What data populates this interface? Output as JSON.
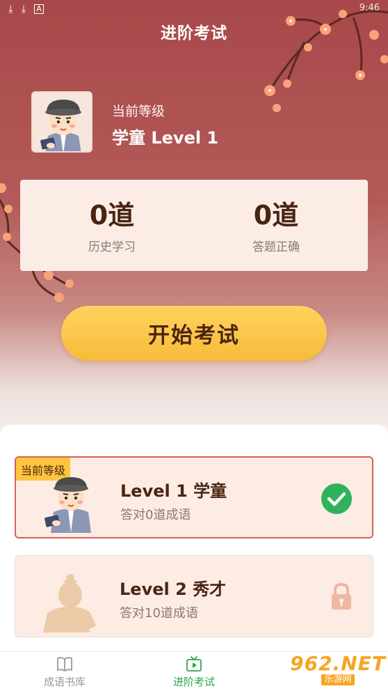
{
  "status_bar": {
    "icons": [
      "download-icon",
      "download-icon",
      "a-icon"
    ],
    "time": "9:46"
  },
  "header": {
    "title": "进阶考试"
  },
  "profile": {
    "level_label": "当前等级",
    "level_value": "学童 Level 1"
  },
  "stats": [
    {
      "value": "0道",
      "label": "历史学习"
    },
    {
      "value": "0道",
      "label": "答题正确"
    }
  ],
  "start_button": {
    "label": "开始考试"
  },
  "levels": [
    {
      "badge": "当前等级",
      "title": "Level 1 学童",
      "subtitle": "答对0道成语",
      "status_icon": "check-circle-icon"
    },
    {
      "title": "Level 2 秀才",
      "subtitle": "答对10道成语",
      "status_icon": "lock-icon"
    }
  ],
  "bottom_nav": [
    {
      "label": "成语书库",
      "icon": "book-icon",
      "active": false
    },
    {
      "label": "进阶考试",
      "icon": "tv-play-icon",
      "active": true
    }
  ],
  "watermark": {
    "main": "962.NET",
    "sub": "乐游网"
  },
  "colors": {
    "hero_top": "#a8484a",
    "accent_yellow": "#ffc53f",
    "text_brown": "#4a2412",
    "success_green": "#2ca84a",
    "current_border": "#d6605c"
  }
}
